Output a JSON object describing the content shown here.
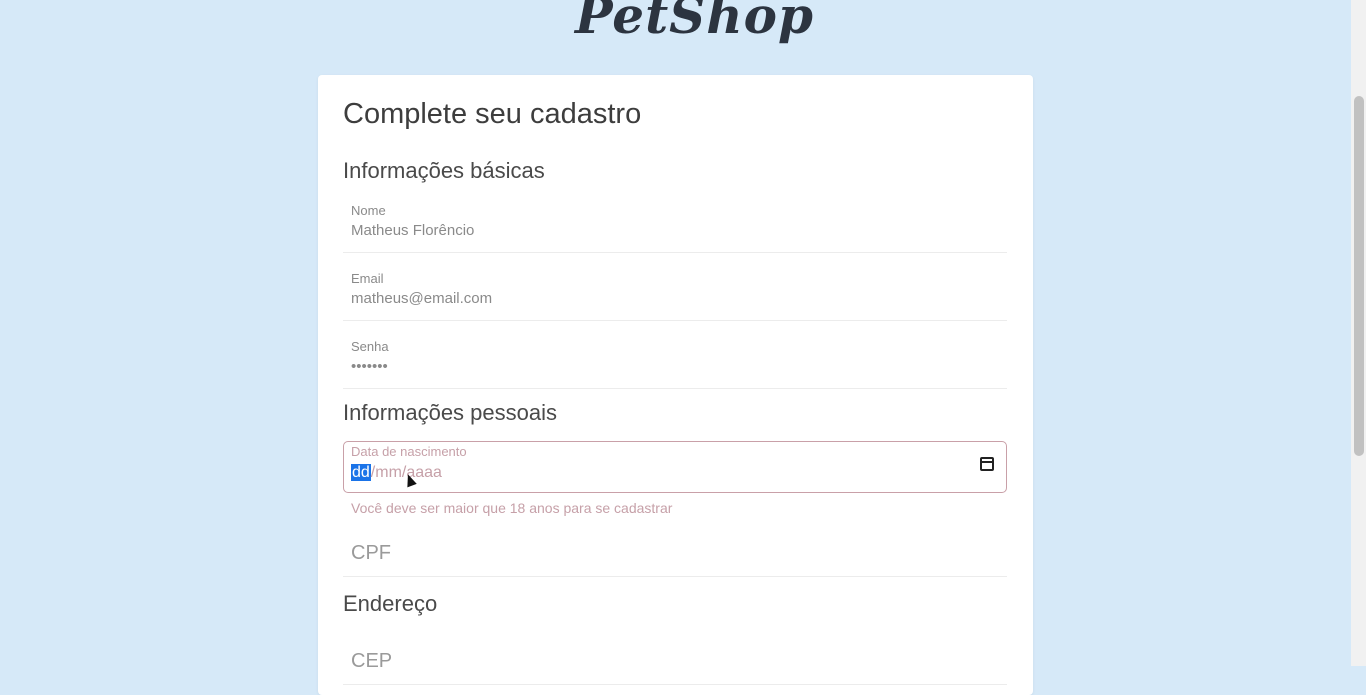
{
  "logo": "PetShop",
  "form": {
    "title": "Complete seu cadastro",
    "section_basic": "Informações básicas",
    "name_label": "Nome",
    "name_value": "Matheus Florêncio",
    "email_label": "Email",
    "email_value": "matheus@email.com",
    "password_label": "Senha",
    "password_value": "•••••••",
    "section_personal": "Informações pessoais",
    "birth_label": "Data de nascimento",
    "birth_dd": "dd",
    "birth_rest": "/mm/aaaa",
    "birth_error": "Você deve ser maior que 18 anos para se cadastrar",
    "cpf_placeholder": "CPF",
    "section_address": "Endereço",
    "cep_placeholder": "CEP"
  },
  "icons": {
    "calendar": "calendar-icon",
    "cursor": "mouse-pointer-icon"
  },
  "colors": {
    "background": "#d6e9f8",
    "error": "#c6a0a8",
    "selection": "#1a73e8"
  }
}
